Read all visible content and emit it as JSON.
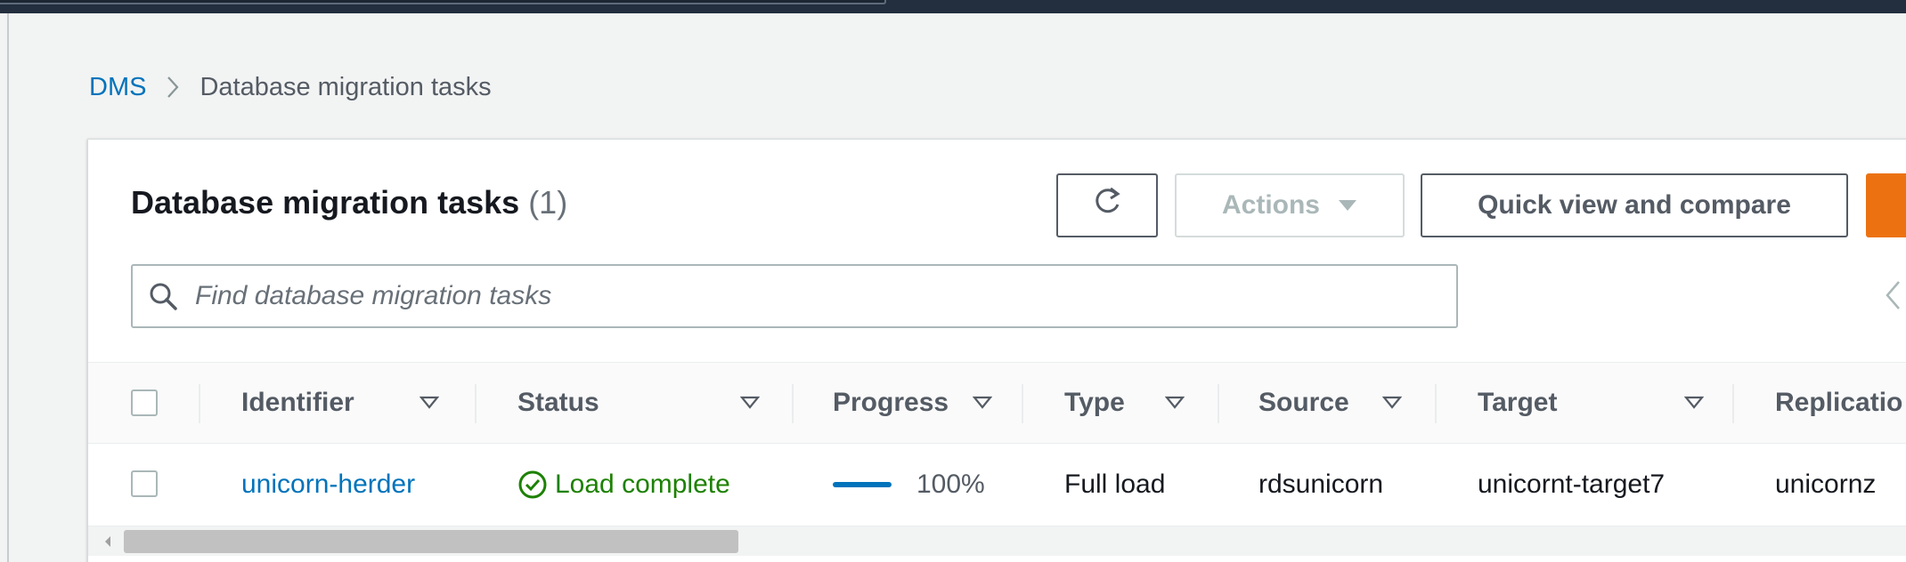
{
  "breadcrumb": {
    "root": "DMS",
    "current": "Database migration tasks"
  },
  "panel": {
    "title": "Database migration tasks",
    "count": "(1)"
  },
  "toolbar": {
    "refresh_icon": "refresh-icon",
    "actions_label": "Actions",
    "quick_view_label": "Quick view and compare"
  },
  "search": {
    "placeholder": "Find database migration tasks"
  },
  "table": {
    "columns": [
      "Identifier",
      "Status",
      "Progress",
      "Type",
      "Source",
      "Target",
      "Replicatio"
    ],
    "rows": [
      {
        "identifier": "unicorn-herder",
        "status": "Load complete",
        "progress_text": "100%",
        "progress_value": 1.0,
        "type": "Full load",
        "source": "rdsunicorn",
        "target": "unicornt-target7",
        "replication": "unicornz"
      }
    ]
  },
  "colors": {
    "link": "#0073bb",
    "success": "#1d8102",
    "primary": "#ec7211",
    "header_bg": "#232f3e"
  }
}
